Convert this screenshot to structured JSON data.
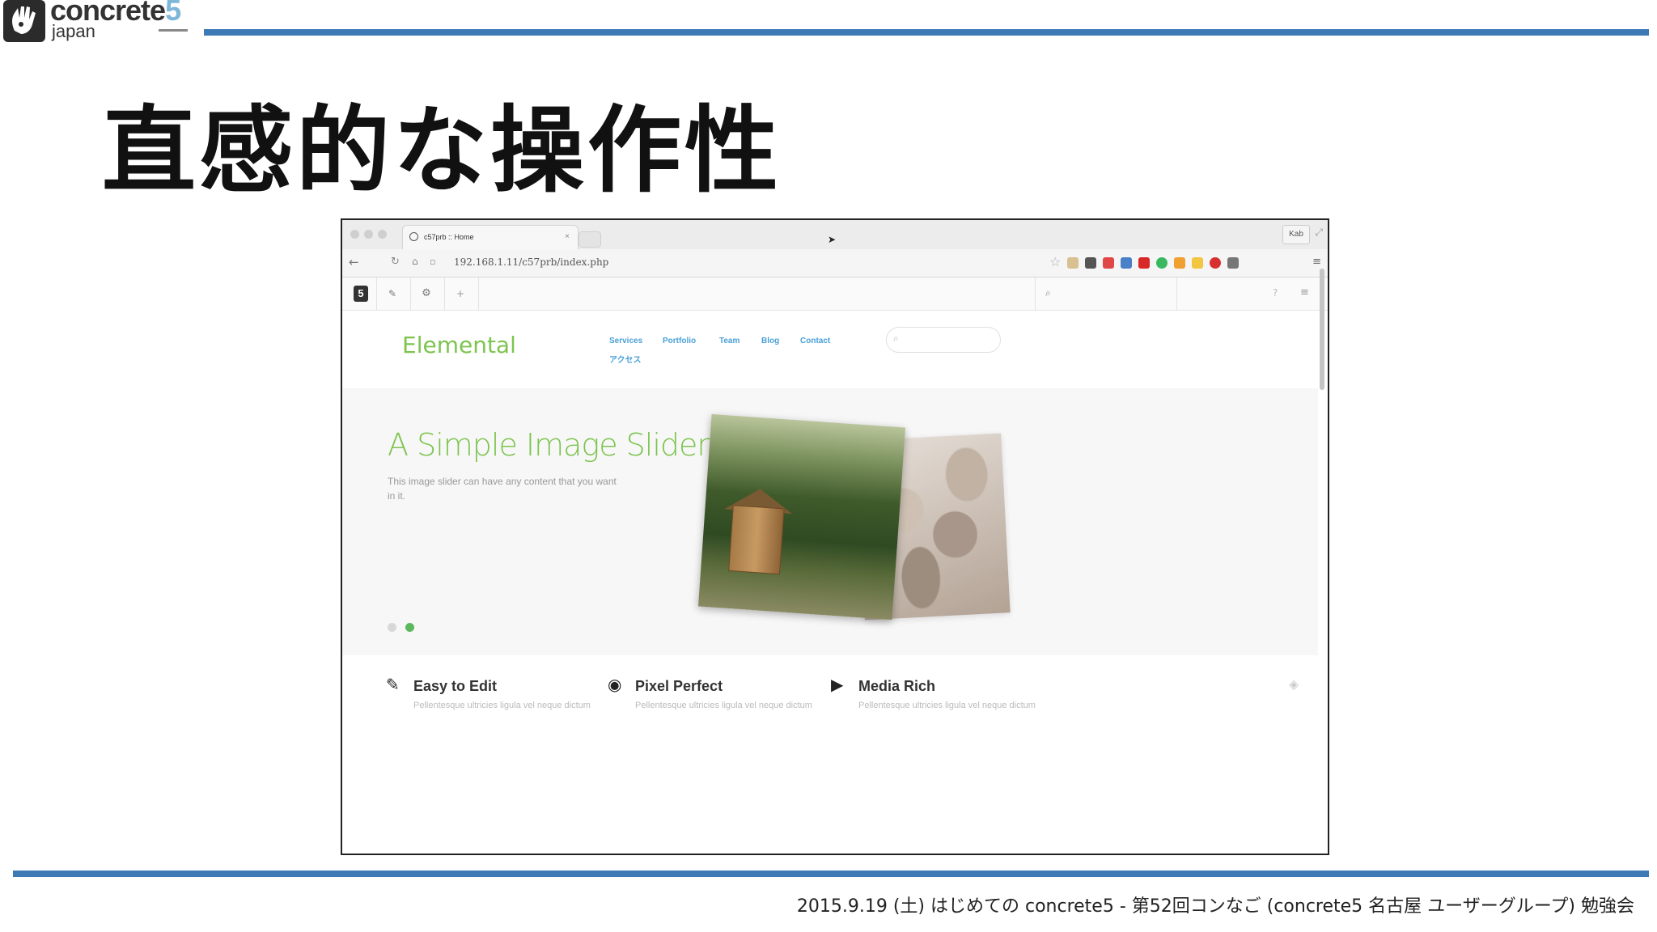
{
  "logo": {
    "word": "concrete",
    "digit": "5",
    "sub": "japan"
  },
  "slide": {
    "title": "直感的な操作性",
    "footer": "2015.9.19 (土) はじめての concrete5 - 第52回コンなご (concrete5 名古屋 ユーザーグループ) 勉強会"
  },
  "browser": {
    "tab_title": "c57prb :: Home",
    "tab_close": "×",
    "profile": "Kab",
    "url": "192.168.1.11/c57prb/index.php"
  },
  "c5_toolbar": {
    "logo": "5",
    "edit_icon": "pencil-icon",
    "settings_icon": "gear-icon",
    "add_icon": "plus-icon"
  },
  "site": {
    "name": "Elemental",
    "nav": [
      "Services",
      "Portfolio",
      "Team",
      "Blog",
      "Contact",
      "アクセス"
    ],
    "hero": {
      "title": "A Simple Image Slider",
      "text": "This image slider can have any content that you want in it."
    },
    "features": [
      {
        "icon": "pencil-icon",
        "title": "Easy to Edit",
        "text": "Pellentesque ultricies ligula vel neque dictum"
      },
      {
        "icon": "eye-icon",
        "title": "Pixel Perfect",
        "text": "Pellentesque ultricies ligula vel neque dictum"
      },
      {
        "icon": "play-icon",
        "title": "Media Rich",
        "text": "Pellentesque ultricies ligula vel neque dictum"
      }
    ]
  },
  "colors": {
    "accent_rule": "#3d7ab5",
    "site_green": "#7dc44f",
    "nav_blue": "#4aa0d8",
    "highlight_red": "#e82020"
  }
}
